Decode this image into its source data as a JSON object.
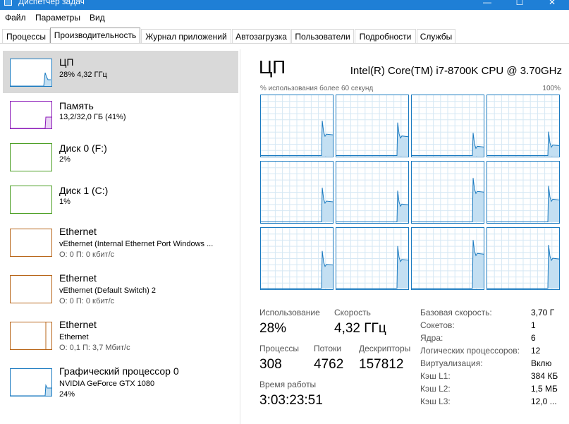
{
  "window": {
    "title": "Диспетчер задач",
    "minimize": "—",
    "maximize": "☐",
    "close": "✕"
  },
  "menu": [
    "Файл",
    "Параметры",
    "Вид"
  ],
  "tabs": [
    "Процессы",
    "Производительность",
    "Журнал приложений",
    "Автозагрузка",
    "Пользователи",
    "Подробности",
    "Службы"
  ],
  "active_tab": "Производительность",
  "colors": {
    "cpu": "#1a7ac0",
    "memory": "#8b1ab8",
    "disk": "#4a9e22",
    "ethernet": "#b8661a",
    "gpu": "#1a7ac0",
    "graph_fill": "#c3dff2",
    "selected_bg": "#d9d9d9"
  },
  "resources": [
    {
      "name": "ЦП",
      "line1": "28% 4,32 ГГц",
      "line2": "",
      "color": "#1a7ac0",
      "icon": "cpu-graph"
    },
    {
      "name": "Память",
      "line1": "13,2/32,0 ГБ (41%)",
      "line2": "",
      "color": "#8b1ab8",
      "icon": "memory-graph"
    },
    {
      "name": "Диск 0 (F:)",
      "line1": "2%",
      "line2": "",
      "color": "#4a9e22",
      "icon": "disk-graph"
    },
    {
      "name": "Диск 1 (C:)",
      "line1": "1%",
      "line2": "",
      "color": "#4a9e22",
      "icon": "disk-graph"
    },
    {
      "name": "Ethernet",
      "line1": "vEthernet (Internal Ethernet Port Windows ...",
      "line2": "О: 0 П: 0 кбит/с",
      "color": "#b8661a",
      "icon": "ethernet-graph"
    },
    {
      "name": "Ethernet",
      "line1": "vEthernet (Default Switch) 2",
      "line2": "О: 0 П: 0 кбит/с",
      "color": "#b8661a",
      "icon": "ethernet-graph"
    },
    {
      "name": "Ethernet",
      "line1": "Ethernet",
      "line2": "О: 0,1 П: 3,7 Мбит/с",
      "color": "#b8661a",
      "icon": "ethernet-graph"
    },
    {
      "name": "Графический процессор 0",
      "line1": "NVIDIA GeForce GTX 1080",
      "line2": "24%",
      "color": "#1a7ac0",
      "icon": "gpu-graph"
    }
  ],
  "detail": {
    "title": "ЦП",
    "model": "Intel(R) Core(TM) i7-8700K CPU @ 3.70GHz",
    "graph_label": "% использования более 60 секунд",
    "graph_max": "100%",
    "core_count_shown": 12,
    "stats": {
      "usage_label": "Использование",
      "usage_value": "28%",
      "speed_label": "Скорость",
      "speed_value": "4,32 ГГц",
      "processes_label": "Процессы",
      "processes_value": "308",
      "threads_label": "Потоки",
      "threads_value": "4762",
      "handles_label": "Дескрипторы",
      "handles_value": "157812",
      "uptime_label": "Время работы",
      "uptime_value": "3:03:23:51"
    },
    "info": [
      {
        "key": "Базовая скорость:",
        "value": "3,70 Г"
      },
      {
        "key": "Сокетов:",
        "value": "1"
      },
      {
        "key": "Ядра:",
        "value": "6"
      },
      {
        "key": "Логических процессоров:",
        "value": "12"
      },
      {
        "key": "Виртуализация:",
        "value": "Вклю"
      },
      {
        "key": "Кэш L1:",
        "value": "384 КБ"
      },
      {
        "key": "Кэш L2:",
        "value": "1,5 МБ"
      },
      {
        "key": "Кэш L3:",
        "value": "12,0 ..."
      }
    ]
  }
}
